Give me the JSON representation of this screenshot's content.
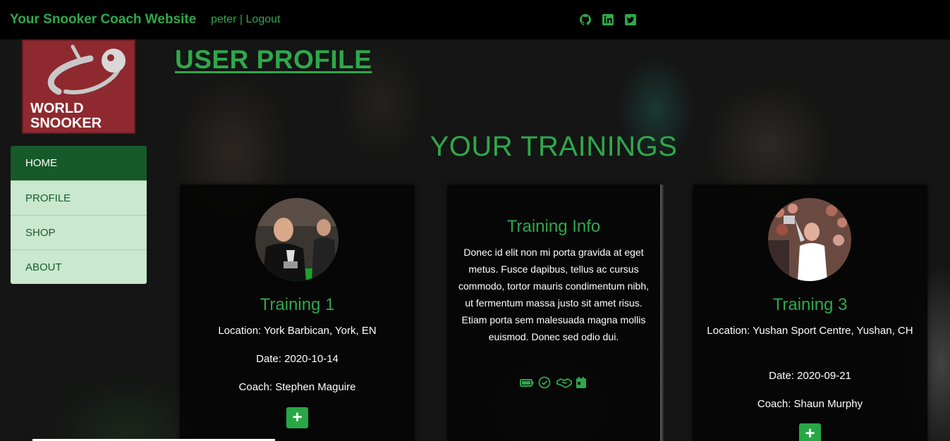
{
  "navbar": {
    "brand": "Your Snooker Coach Website",
    "username": "peter",
    "separator": " | ",
    "logout": "Logout",
    "social_icons": [
      "github-icon",
      "linkedin-icon",
      "twitter-icon"
    ]
  },
  "logo": {
    "text_line1": "WORLD",
    "text_line2": "SNOOKER"
  },
  "sidebar": {
    "items": [
      {
        "label": "HOME",
        "active": true
      },
      {
        "label": "PROFILE",
        "active": false
      },
      {
        "label": "SHOP",
        "active": false
      },
      {
        "label": "ABOUT",
        "active": false
      }
    ]
  },
  "page": {
    "title": "USER PROFILE",
    "section_title": "YOUR TRAININGS"
  },
  "cards": {
    "training1": {
      "title": "Training 1",
      "location": "Location: York Barbican, York, EN",
      "date": "Date: 2020-10-14",
      "coach": "Coach: Stephen Maguire",
      "button": "+"
    },
    "info": {
      "title": "Training Info",
      "text": "Donec id elit non mi porta gravida at eget metus. Fusce dapibus, tellus ac cursus commodo, tortor mauris condimentum nibh, ut fermentum massa justo sit amet risus. Etiam porta sem malesuada magna mollis euismod. Donec sed odio dui.",
      "icons": [
        "battery-icon",
        "check-circle-icon",
        "handshake-icon",
        "calendar-icon"
      ]
    },
    "training3": {
      "title": "Training 3",
      "location": "Location: Yushan Sport Centre, Yushan, CH",
      "date": "Date: 2020-09-21",
      "coach": "Coach: Shaun Murphy",
      "button": "+"
    }
  },
  "colors": {
    "accent": "#2ea84a",
    "nav_bg": "#000000",
    "sidebar_active": "#155a28",
    "sidebar_item": "#c9e8ce",
    "button": "#28a745"
  }
}
